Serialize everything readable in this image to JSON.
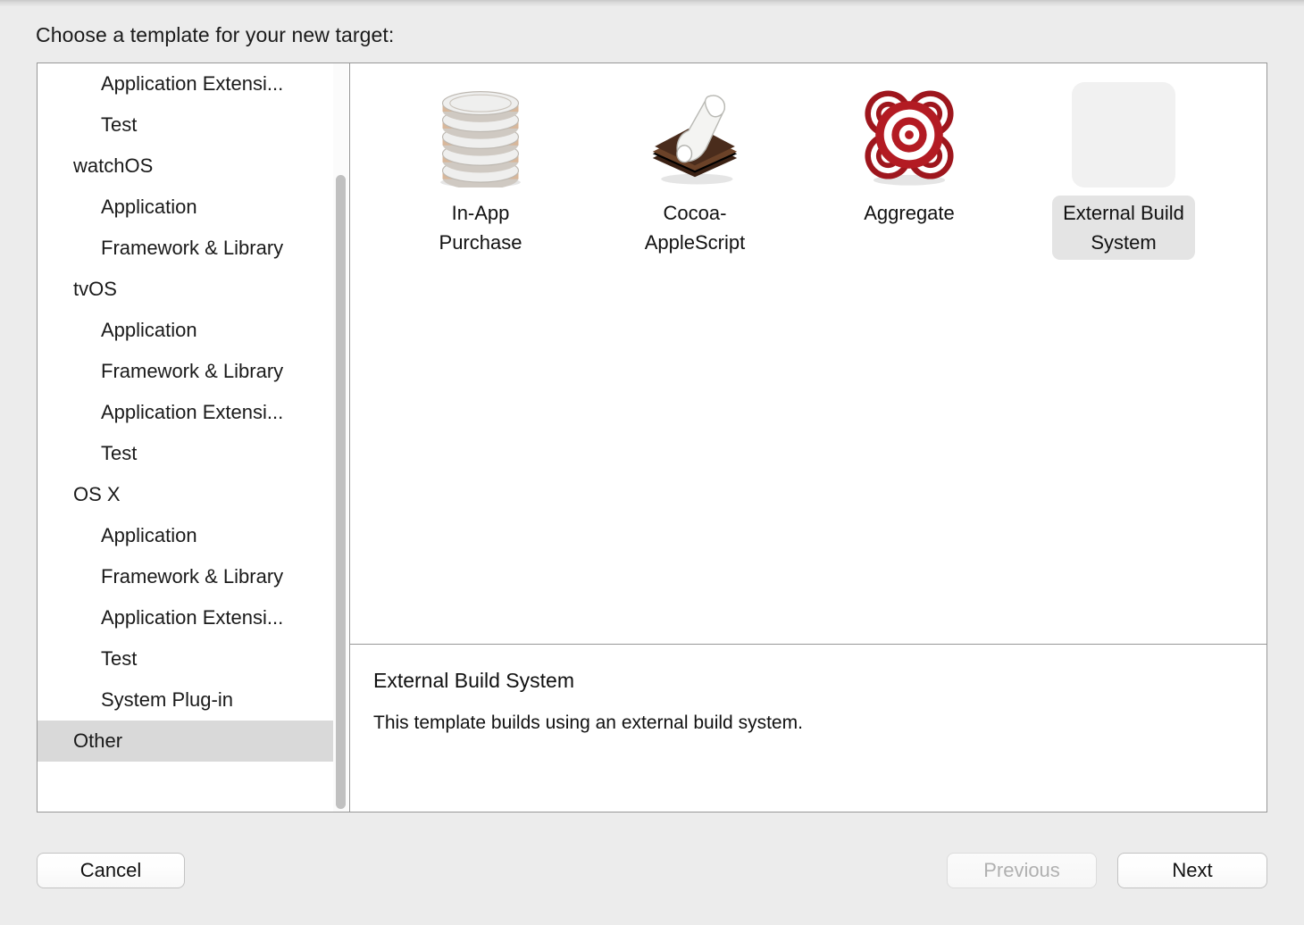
{
  "dialog": {
    "prompt": "Choose a template for your new target:"
  },
  "sidebar": {
    "items": [
      {
        "label": "Application Extensi...",
        "level": "child",
        "selected": false
      },
      {
        "label": "Test",
        "level": "child",
        "selected": false
      },
      {
        "label": "watchOS",
        "level": "group",
        "selected": false
      },
      {
        "label": "Application",
        "level": "child",
        "selected": false
      },
      {
        "label": "Framework & Library",
        "level": "child",
        "selected": false
      },
      {
        "label": "tvOS",
        "level": "group",
        "selected": false
      },
      {
        "label": "Application",
        "level": "child",
        "selected": false
      },
      {
        "label": "Framework & Library",
        "level": "child",
        "selected": false
      },
      {
        "label": "Application Extensi...",
        "level": "child",
        "selected": false
      },
      {
        "label": "Test",
        "level": "child",
        "selected": false
      },
      {
        "label": "OS X",
        "level": "group",
        "selected": false
      },
      {
        "label": "Application",
        "level": "child",
        "selected": false
      },
      {
        "label": "Framework & Library",
        "level": "child",
        "selected": false
      },
      {
        "label": "Application Extensi...",
        "level": "child",
        "selected": false
      },
      {
        "label": "Test",
        "level": "child",
        "selected": false
      },
      {
        "label": "System Plug-in",
        "level": "child",
        "selected": false
      },
      {
        "label": "Other",
        "level": "group",
        "selected": true
      }
    ]
  },
  "templates": [
    {
      "label": "In-App\nPurchase",
      "icon": "coin-stack-icon",
      "selected": false
    },
    {
      "label": "Cocoa-\nAppleScript",
      "icon": "applescript-scroll-icon",
      "selected": false
    },
    {
      "label": "Aggregate",
      "icon": "aggregate-target-icon",
      "selected": false
    },
    {
      "label": "External Build\nSystem",
      "icon": "blank-placeholder-icon",
      "selected": true
    }
  ],
  "details": {
    "title": "External Build System",
    "body": "This template builds using an external build system."
  },
  "buttons": {
    "cancel": "Cancel",
    "previous": "Previous",
    "next": "Next"
  },
  "colors": {
    "window_background": "#ececec",
    "panel_background": "#ffffff",
    "panel_border": "#979797",
    "selection_sidebar": "#d9d9d9",
    "selection_label": "#e4e4e4",
    "aggregate_red": "#b31b23",
    "applescript_brown": "#4a2c1c",
    "disabled_text": "#b0b0b0"
  }
}
